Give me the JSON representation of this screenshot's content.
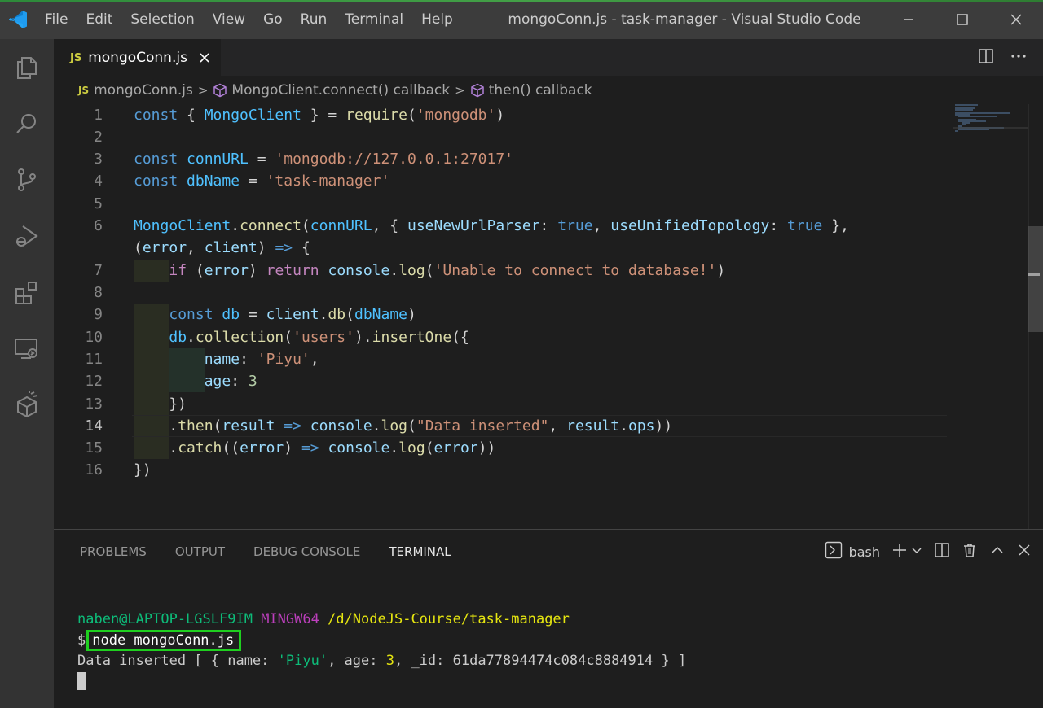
{
  "window": {
    "title": "mongoConn.js - task-manager - Visual Studio Code",
    "menu": [
      "File",
      "Edit",
      "Selection",
      "View",
      "Go",
      "Run",
      "Terminal",
      "Help"
    ]
  },
  "tab": {
    "badge": "JS",
    "name": "mongoConn.js"
  },
  "breadcrumb": {
    "badge": "JS",
    "file": "mongoConn.js",
    "symbol1": "MongoClient.connect() callback",
    "symbol2": "then() callback"
  },
  "editor": {
    "line_numbers": [
      "1",
      "2",
      "3",
      "4",
      "5",
      "6",
      "",
      "7",
      "8",
      "9",
      "10",
      "11",
      "12",
      "13",
      "14",
      "15",
      "16"
    ],
    "active_line": "14"
  },
  "panel": {
    "tabs": [
      "PROBLEMS",
      "OUTPUT",
      "DEBUG CONSOLE",
      "TERMINAL"
    ],
    "active_tab": "TERMINAL",
    "shell": "bash",
    "prompt_user": "naben@LAPTOP-LGSLF9IM",
    "prompt_env": "MINGW64",
    "prompt_path": "/d/NodeJS-Course/task-manager",
    "prompt_symbol": "$",
    "command": "node mongoConn.js",
    "output_prefix": "Data inserted [ { name: ",
    "output_name": "'Piyu'",
    "output_mid": ", age: ",
    "output_age": "3",
    "output_suffix": ", _id: 61da77894474c084c8884914 } ]"
  },
  "icons": {
    "activity": [
      "explorer-icon",
      "search-icon",
      "source-control-icon",
      "run-debug-icon",
      "extensions-icon",
      "remote-explorer-icon",
      "docker-icon"
    ]
  },
  "colors": {
    "accent_highlight": "#1fcf1f",
    "titlebar": "#3c3c3c",
    "activitybar": "#333333"
  }
}
